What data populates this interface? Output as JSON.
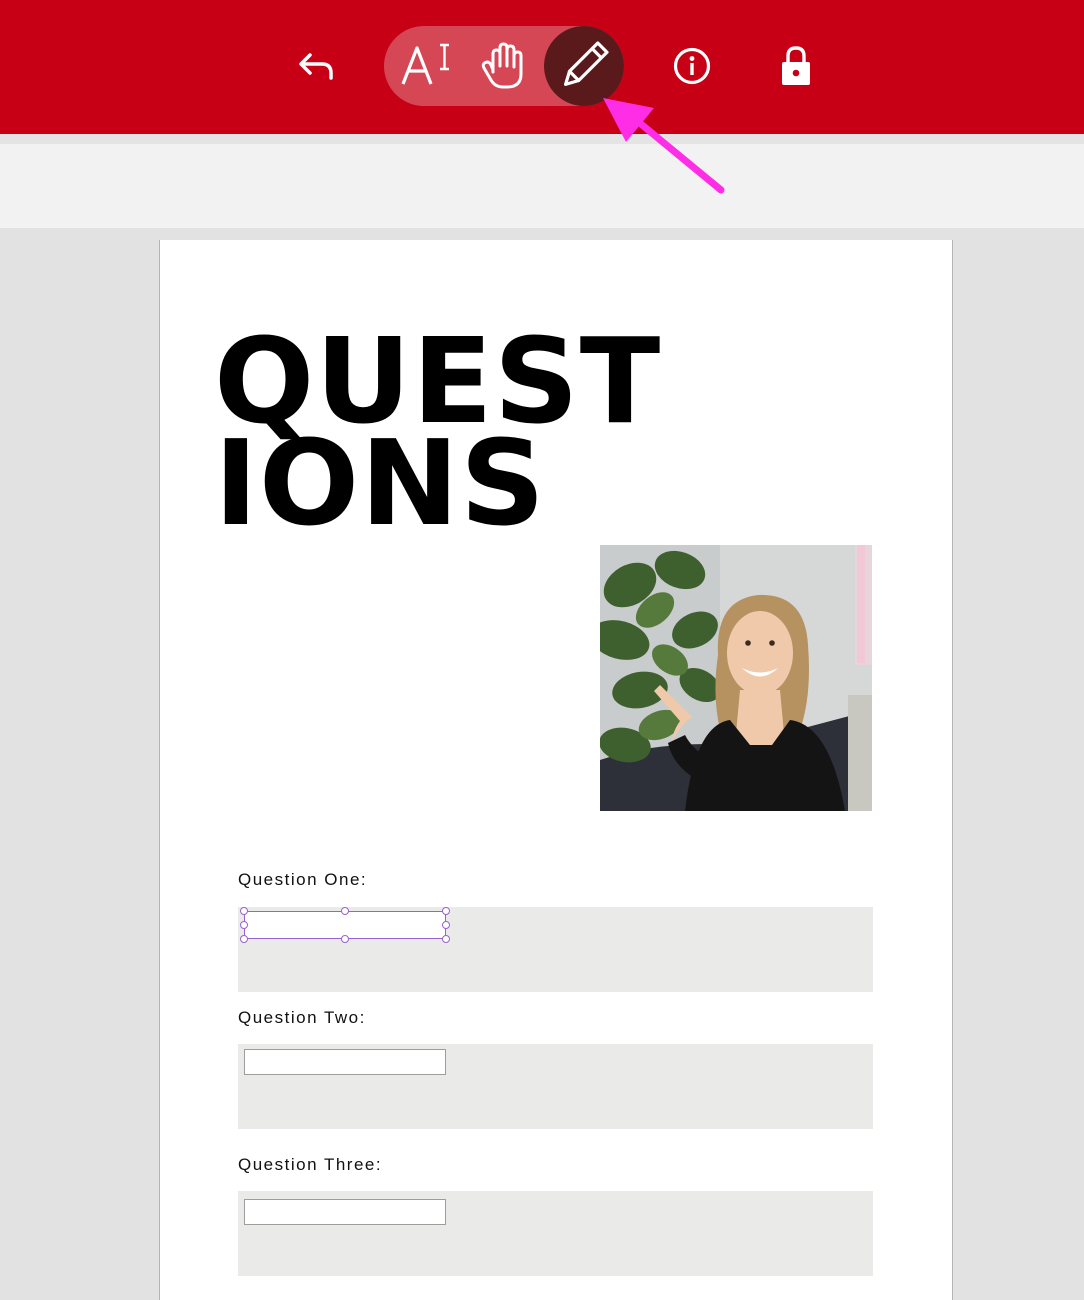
{
  "toolbar": {
    "icons": [
      "undo-icon",
      "text-select-icon",
      "hand-icon",
      "pencil-icon",
      "info-icon",
      "lock-icon"
    ],
    "active_tool": "pencil",
    "colors": {
      "bar": "#c70016",
      "active": "#5a1a1c",
      "annotation_arrow": "#ff2ee6"
    }
  },
  "document": {
    "title_line1": "QUEST",
    "title_line2": "IONS",
    "photo": "woman-pointing-photo",
    "questions": [
      {
        "label": "Question One:"
      },
      {
        "label": "Question Two:"
      },
      {
        "label": "Question Three:"
      }
    ]
  }
}
